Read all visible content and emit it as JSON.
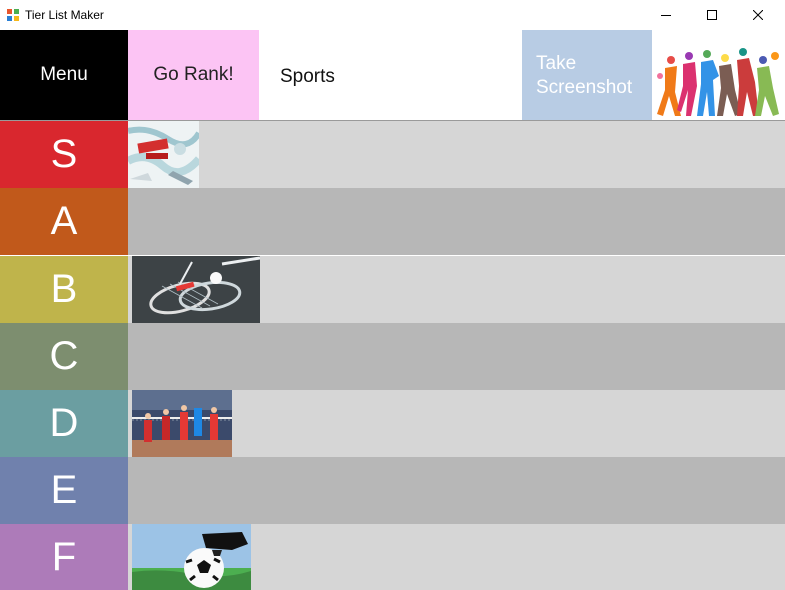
{
  "window": {
    "title": "Tier List Maker",
    "controls": {
      "minimize": "—",
      "maximize": "☐",
      "close": "✕"
    }
  },
  "toolbar": {
    "menu_label": "Menu",
    "rank_label": "Go Rank!",
    "list_title": "Sports",
    "screenshot_label": "Take\nScreenshot",
    "banner_icon": "sports-silhouettes-image"
  },
  "colors": {
    "menu_bg": "#000000",
    "rank_bg": "#fcc4f4",
    "screenshot_bg": "#b8cce4",
    "row_light": "#d6d6d6",
    "row_dark": "#b7b7b7"
  },
  "tiers": [
    {
      "label": "S",
      "color": "#d9272e",
      "items": [
        "hockey-image"
      ]
    },
    {
      "label": "A",
      "color": "#c1591b",
      "items": []
    },
    {
      "label": "B",
      "color": "#bfb44b",
      "items": [
        "badminton-image"
      ]
    },
    {
      "label": "C",
      "color": "#7d8e6f",
      "items": []
    },
    {
      "label": "D",
      "color": "#6b9ea1",
      "items": [
        "volleyball-image"
      ]
    },
    {
      "label": "E",
      "color": "#7081ad",
      "items": []
    },
    {
      "label": "F",
      "color": "#ad7bb9",
      "items": [
        "soccer-image"
      ]
    }
  ]
}
